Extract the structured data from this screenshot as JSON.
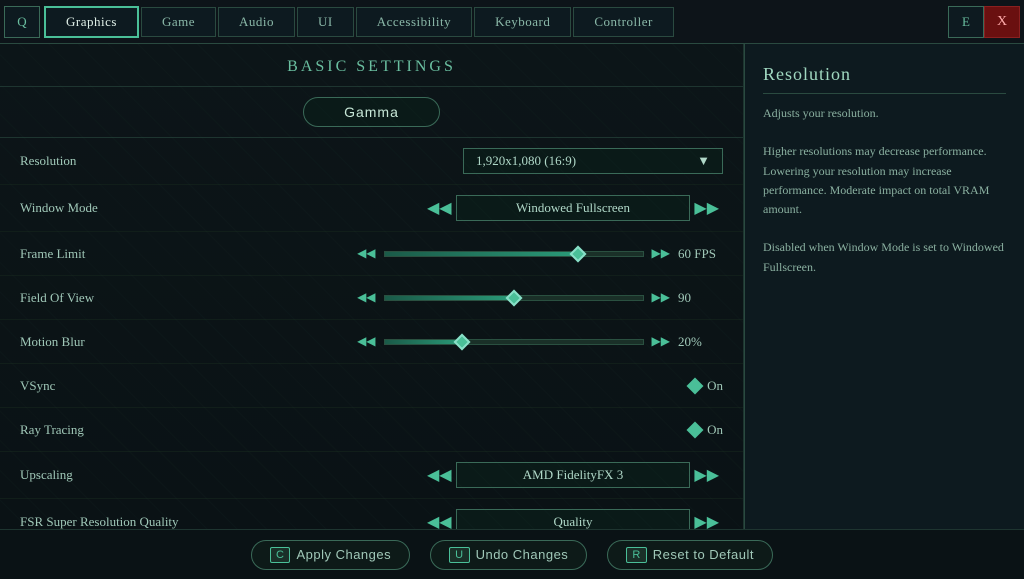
{
  "nav": {
    "left_icon": "Q",
    "right_icon": "E",
    "close_icon": "X",
    "tabs": [
      {
        "label": "Graphics",
        "active": true
      },
      {
        "label": "Game",
        "active": false
      },
      {
        "label": "Audio",
        "active": false
      },
      {
        "label": "UI",
        "active": false
      },
      {
        "label": "Accessibility",
        "active": false
      },
      {
        "label": "Keyboard",
        "active": false
      },
      {
        "label": "Controller",
        "active": false
      }
    ]
  },
  "main": {
    "section_title": "Basic Settings",
    "gamma_button": "Gamma",
    "settings": [
      {
        "label": "Resolution",
        "type": "dropdown",
        "value": "1,920x1,080 (16:9)"
      },
      {
        "label": "Window Mode",
        "type": "arrow-selector",
        "value": "Windowed Fullscreen"
      },
      {
        "label": "Frame Limit",
        "type": "slider",
        "value": "60 FPS",
        "fill_pct": 75
      },
      {
        "label": "Field Of View",
        "type": "slider",
        "value": "90",
        "fill_pct": 50
      },
      {
        "label": "Motion Blur",
        "type": "slider",
        "value": "20%",
        "fill_pct": 30
      },
      {
        "label": "VSync",
        "type": "toggle",
        "value": "On"
      },
      {
        "label": "Ray Tracing",
        "type": "toggle",
        "value": "On"
      },
      {
        "label": "Upscaling",
        "type": "arrow-selector",
        "value": "AMD FidelityFX 3"
      },
      {
        "label": "FSR Super Resolution Quality",
        "type": "arrow-selector",
        "value": "Quality"
      }
    ]
  },
  "sidebar": {
    "title": "Resolution",
    "description": "Adjusts your resolution.\n\nHigher resolutions may decrease performance. Lowering your resolution may increase performance. Moderate impact on total VRAM amount.\n\nDisabled when Window Mode is set to Windowed Fullscreen."
  },
  "bottom": {
    "apply_key": "C",
    "apply_label": "Apply Changes",
    "undo_key": "U",
    "undo_label": "Undo Changes",
    "reset_key": "R",
    "reset_label": "Reset to Default"
  }
}
